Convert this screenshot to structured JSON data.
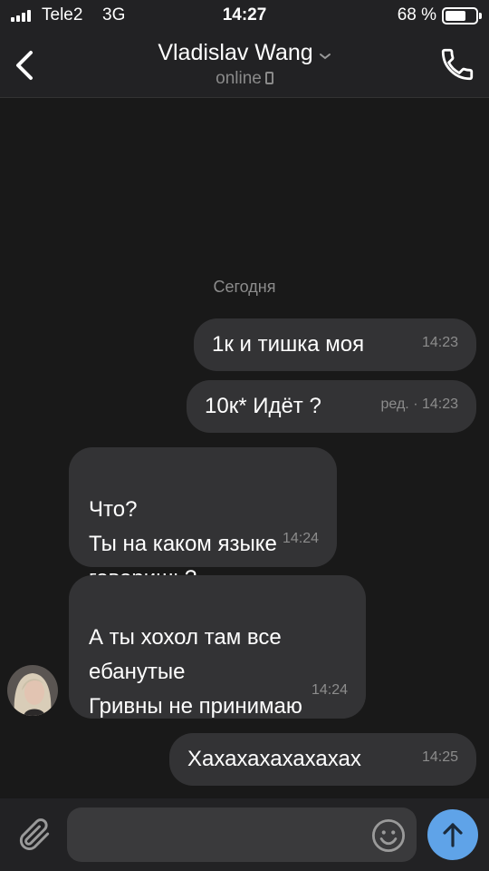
{
  "status_bar": {
    "carrier": "Tele2",
    "network": "3G",
    "time": "14:27",
    "battery_percent_label": "68 %",
    "battery_level": 0.68
  },
  "header": {
    "back_icon": "chevron-left-icon",
    "contact_name": "Vladislav Wang",
    "status": "online",
    "call_icon": "phone-icon"
  },
  "chat": {
    "date_separator": "Сегодня",
    "messages": [
      {
        "direction": "out",
        "text": "1к и тишка моя",
        "time": "14:23"
      },
      {
        "direction": "out",
        "text": "10к* Идёт ?",
        "time": "ред. · 14:23"
      },
      {
        "direction": "in",
        "text": "Что?\nТы на каком языке\nговоришь?",
        "time": "14:24"
      },
      {
        "direction": "in",
        "text": "А ты хохол там все\nебанутые\nГривны не принимаю",
        "time": "14:24"
      },
      {
        "direction": "out",
        "text": "Хахахахахахахах",
        "time": "14:25"
      }
    ]
  },
  "input_bar": {
    "placeholder": "",
    "attach_icon": "paperclip-icon",
    "emoji_icon": "smile-icon",
    "send_icon": "arrow-up-icon"
  },
  "colors": {
    "background": "#191919",
    "bar": "#222224",
    "bubble": "#333335",
    "accent": "#5fa3e8"
  }
}
